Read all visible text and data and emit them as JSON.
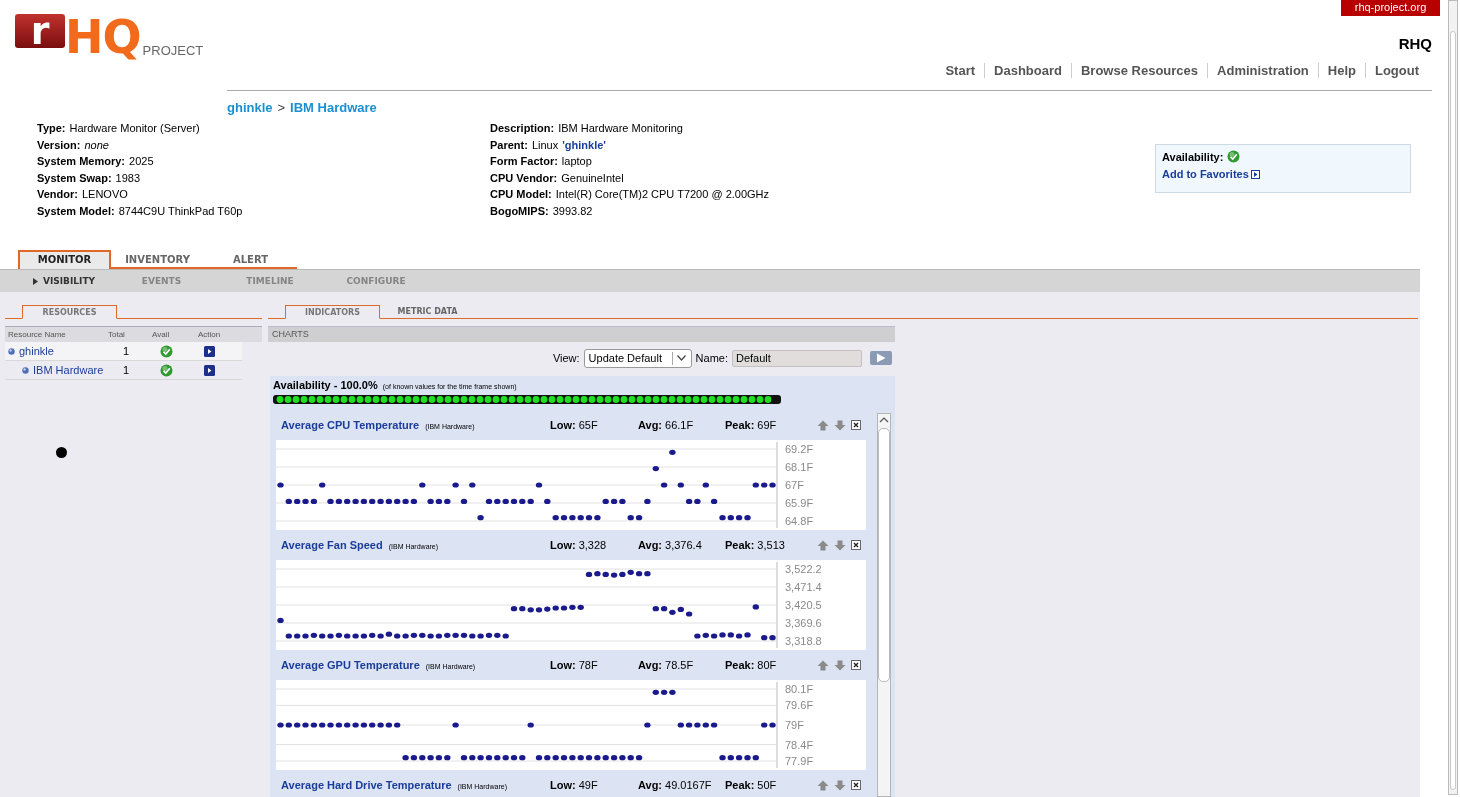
{
  "site_badge": "rhq-project.org",
  "logo": {
    "mark": "r",
    "name": "HQ",
    "suffix": "PROJECT"
  },
  "app_title": "RHQ",
  "nav": [
    "Start",
    "Dashboard",
    "Browse Resources",
    "Administration",
    "Help",
    "Logout"
  ],
  "breadcrumb": {
    "items": [
      "ghinkle",
      "IBM Hardware"
    ],
    "separator": ">"
  },
  "properties_left": [
    {
      "label": "Type:",
      "value": "Hardware Monitor (Server)"
    },
    {
      "label": "Version:",
      "value": "none",
      "italic": true
    },
    {
      "label": "System Memory:",
      "value": "2025"
    },
    {
      "label": "System Swap:",
      "value": "1983"
    },
    {
      "label": "Vendor:",
      "value": "LENOVO"
    },
    {
      "label": "System Model:",
      "value": "8744C9U ThinkPad T60p"
    }
  ],
  "properties_right": [
    {
      "label": "Description:",
      "value": "IBM Hardware Monitoring"
    },
    {
      "label": "Parent:",
      "value": "Linux",
      "link": "'ghinkle'"
    },
    {
      "label": "Form Factor:",
      "value": "laptop"
    },
    {
      "label": "CPU Vendor:",
      "value": "GenuineIntel"
    },
    {
      "label": "CPU Model:",
      "value": "Intel(R) Core(TM)2 CPU T7200 @ 2.00GHz"
    },
    {
      "label": "BogoMIPS:",
      "value": "3993.82"
    }
  ],
  "availability_box": {
    "label": "Availability:",
    "available": true,
    "link": "Add to Favorites"
  },
  "tabs": [
    {
      "label": "MONITOR",
      "selected": true
    },
    {
      "label": "INVENTORY",
      "selected": false
    },
    {
      "label": "ALERT",
      "selected": false
    }
  ],
  "subtabs": [
    {
      "label": "VISIBILITY",
      "selected": true,
      "disabled": false
    },
    {
      "label": "EVENTS",
      "selected": false,
      "disabled": true
    },
    {
      "label": "TIMELINE",
      "selected": false,
      "disabled": true
    },
    {
      "label": "CONFIGURE",
      "selected": false,
      "disabled": true
    }
  ],
  "resources_panel": {
    "tab": "RESOURCES",
    "columns": [
      "Resource Name",
      "Total",
      "Avail",
      "Action"
    ],
    "rows": [
      {
        "name": "ghinkle",
        "total": "1",
        "available": true,
        "children": [
          {
            "name": "IBM Hardware",
            "total": "1",
            "available": true
          }
        ]
      }
    ]
  },
  "indicator_tabs": [
    {
      "label": "INDICATORS",
      "selected": true
    },
    {
      "label": "METRIC DATA",
      "selected": false
    }
  ],
  "charts_section": {
    "title": "CHARTS",
    "view_label": "View:",
    "view_value": "Update Default",
    "name_label": "Name:",
    "name_value": "Default"
  },
  "availability": {
    "title": "Availability - 100.0%",
    "note": "(of known values for the time frame shown)"
  },
  "metrics": [
    {
      "title": "Average CPU Temperature",
      "resource": "(IBM Hardware)",
      "stats": [
        {
          "label": "Low:",
          "value": "65F"
        },
        {
          "label": "Avg:",
          "value": "66.1F"
        },
        {
          "label": "Peak:",
          "value": "69F"
        }
      ],
      "chart_data": {
        "type": "scatter",
        "grid": true,
        "ylim": [
          64.8,
          69.2
        ],
        "yticks": [
          {
            "value": 69.2,
            "label": "69.2F"
          },
          {
            "value": 68.1,
            "label": "68.1F"
          },
          {
            "value": 67,
            "label": "67F"
          },
          {
            "value": 65.9,
            "label": "65.9F"
          },
          {
            "value": 64.8,
            "label": "64.8F"
          }
        ],
        "values": [
          67,
          66,
          66,
          66,
          66,
          67,
          66,
          66,
          66,
          66,
          66,
          66,
          66,
          66,
          66,
          66,
          66,
          67,
          66,
          66,
          66,
          67,
          66,
          67,
          65,
          66,
          66,
          66,
          66,
          66,
          66,
          67,
          66,
          65,
          65,
          65,
          65,
          65,
          65,
          66,
          66,
          66,
          65,
          65,
          66,
          68,
          67,
          69,
          67,
          66,
          66,
          67,
          66,
          65,
          65,
          65,
          65,
          67,
          67,
          67
        ]
      }
    },
    {
      "title": "Average Fan Speed",
      "resource": "(IBM Hardware)",
      "stats": [
        {
          "label": "Low:",
          "value": "3,328"
        },
        {
          "label": "Avg:",
          "value": "3,376.4"
        },
        {
          "label": "Peak:",
          "value": "3,513"
        }
      ],
      "chart_data": {
        "type": "scatter",
        "grid": true,
        "ylim": [
          3318.8,
          3522.2
        ],
        "yticks": [
          {
            "value": 3522.2,
            "label": "3,522.2"
          },
          {
            "value": 3471.4,
            "label": "3,471.4"
          },
          {
            "value": 3420.5,
            "label": "3,420.5"
          },
          {
            "value": 3369.6,
            "label": "3,369.6"
          },
          {
            "value": 3318.8,
            "label": "3,318.8"
          }
        ],
        "values": [
          3377,
          3333,
          3333,
          3333,
          3335,
          3333,
          3333,
          3335,
          3333,
          3333,
          3333,
          3335,
          3333,
          3338,
          3333,
          3333,
          3335,
          3335,
          3333,
          3333,
          3335,
          3335,
          3335,
          3333,
          3333,
          3335,
          3335,
          3333,
          3410,
          3410,
          3407,
          3407,
          3409,
          3412,
          3412,
          3414,
          3414,
          3507,
          3509,
          3507,
          3505,
          3507,
          3513,
          3509,
          3509,
          3410,
          3410,
          3400,
          3408,
          3395,
          3333,
          3335,
          3333,
          3336,
          3336,
          3333,
          3336,
          3415,
          3328,
          3328
        ]
      }
    },
    {
      "title": "Average GPU Temperature",
      "resource": "(IBM Hardware)",
      "stats": [
        {
          "label": "Low:",
          "value": "78F"
        },
        {
          "label": "Avg:",
          "value": "78.5F"
        },
        {
          "label": "Peak:",
          "value": "80F"
        }
      ],
      "chart_data": {
        "type": "scatter",
        "grid": true,
        "ylim": [
          77.9,
          80.1
        ],
        "yticks": [
          {
            "value": 80.1,
            "label": "80.1F"
          },
          {
            "value": 79.6,
            "label": "79.6F"
          },
          {
            "value": 79,
            "label": "79F"
          },
          {
            "value": 78.4,
            "label": "78.4F"
          },
          {
            "value": 77.9,
            "label": "77.9F"
          }
        ],
        "values": [
          79,
          79,
          79,
          79,
          79,
          79,
          79,
          79,
          79,
          79,
          79,
          79,
          79,
          79,
          79,
          78,
          78,
          78,
          78,
          78,
          78,
          79,
          78,
          78,
          78,
          78,
          78,
          78,
          78,
          78,
          79,
          78,
          78,
          78,
          78,
          78,
          78,
          78,
          78,
          78,
          78,
          78,
          78,
          78,
          79,
          80,
          80,
          80,
          79,
          79,
          79,
          79,
          79,
          78,
          78,
          78,
          78,
          78,
          79,
          79
        ]
      }
    },
    {
      "title": "Average Hard Drive Temperature",
      "resource": "(IBM Hardware)",
      "stats": [
        {
          "label": "Low:",
          "value": "49F"
        },
        {
          "label": "Avg:",
          "value": "49.0167F"
        },
        {
          "label": "Peak:",
          "value": "50F"
        }
      ]
    }
  ]
}
